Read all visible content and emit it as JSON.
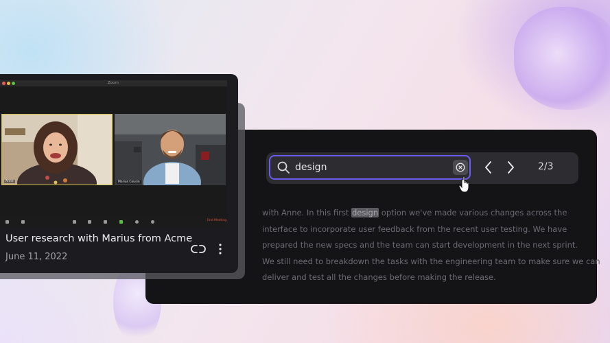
{
  "recording": {
    "window_title": "Zoom",
    "participants": [
      {
        "name": "Anne"
      },
      {
        "name": "Marius Cousin"
      }
    ],
    "end_meeting_label": "End Meeting",
    "title": "User research with Marius from Acme",
    "date": "June 11, 2022"
  },
  "search": {
    "query": "design",
    "match_count": "2/3"
  },
  "transcript": {
    "line1_before": "with Anne.  In this first ",
    "highlight": "design",
    "line1_after": " option we've made various changes across the",
    "line2": "interface to incorporate user feedback from the recent user testing. We have",
    "line3": "prepared the new specs and the team can start development in the next sprint.",
    "line4": "We still need to breakdown the tasks with the engineering team to make sure we can",
    "line5": "deliver and test all the changes before making the release."
  },
  "colors": {
    "accent": "#6d5cf0",
    "panel_bg": "#141417",
    "card_bg": "#1c1c20"
  }
}
